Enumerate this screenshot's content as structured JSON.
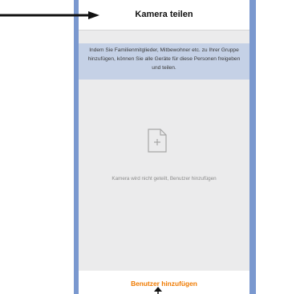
{
  "header": {
    "title": "Kamera teilen"
  },
  "banner": {
    "text": "Indem Sie Familienmitglieder, Mitbewohner etc. zu Ihrer Gruppe hinzufügen, können Sie alle Geräte für diese Personen freigeben und teilen."
  },
  "empty_state": {
    "icon": "document-plus-icon",
    "message": "Kamera wird nicht geteilt, Benutzer hinzufügen"
  },
  "footer": {
    "add_user_label": "Benutzer hinzufügen"
  },
  "colors": {
    "frame": "#7a98cf",
    "banner": "#c5d1e6",
    "accent": "#ef7a00"
  }
}
